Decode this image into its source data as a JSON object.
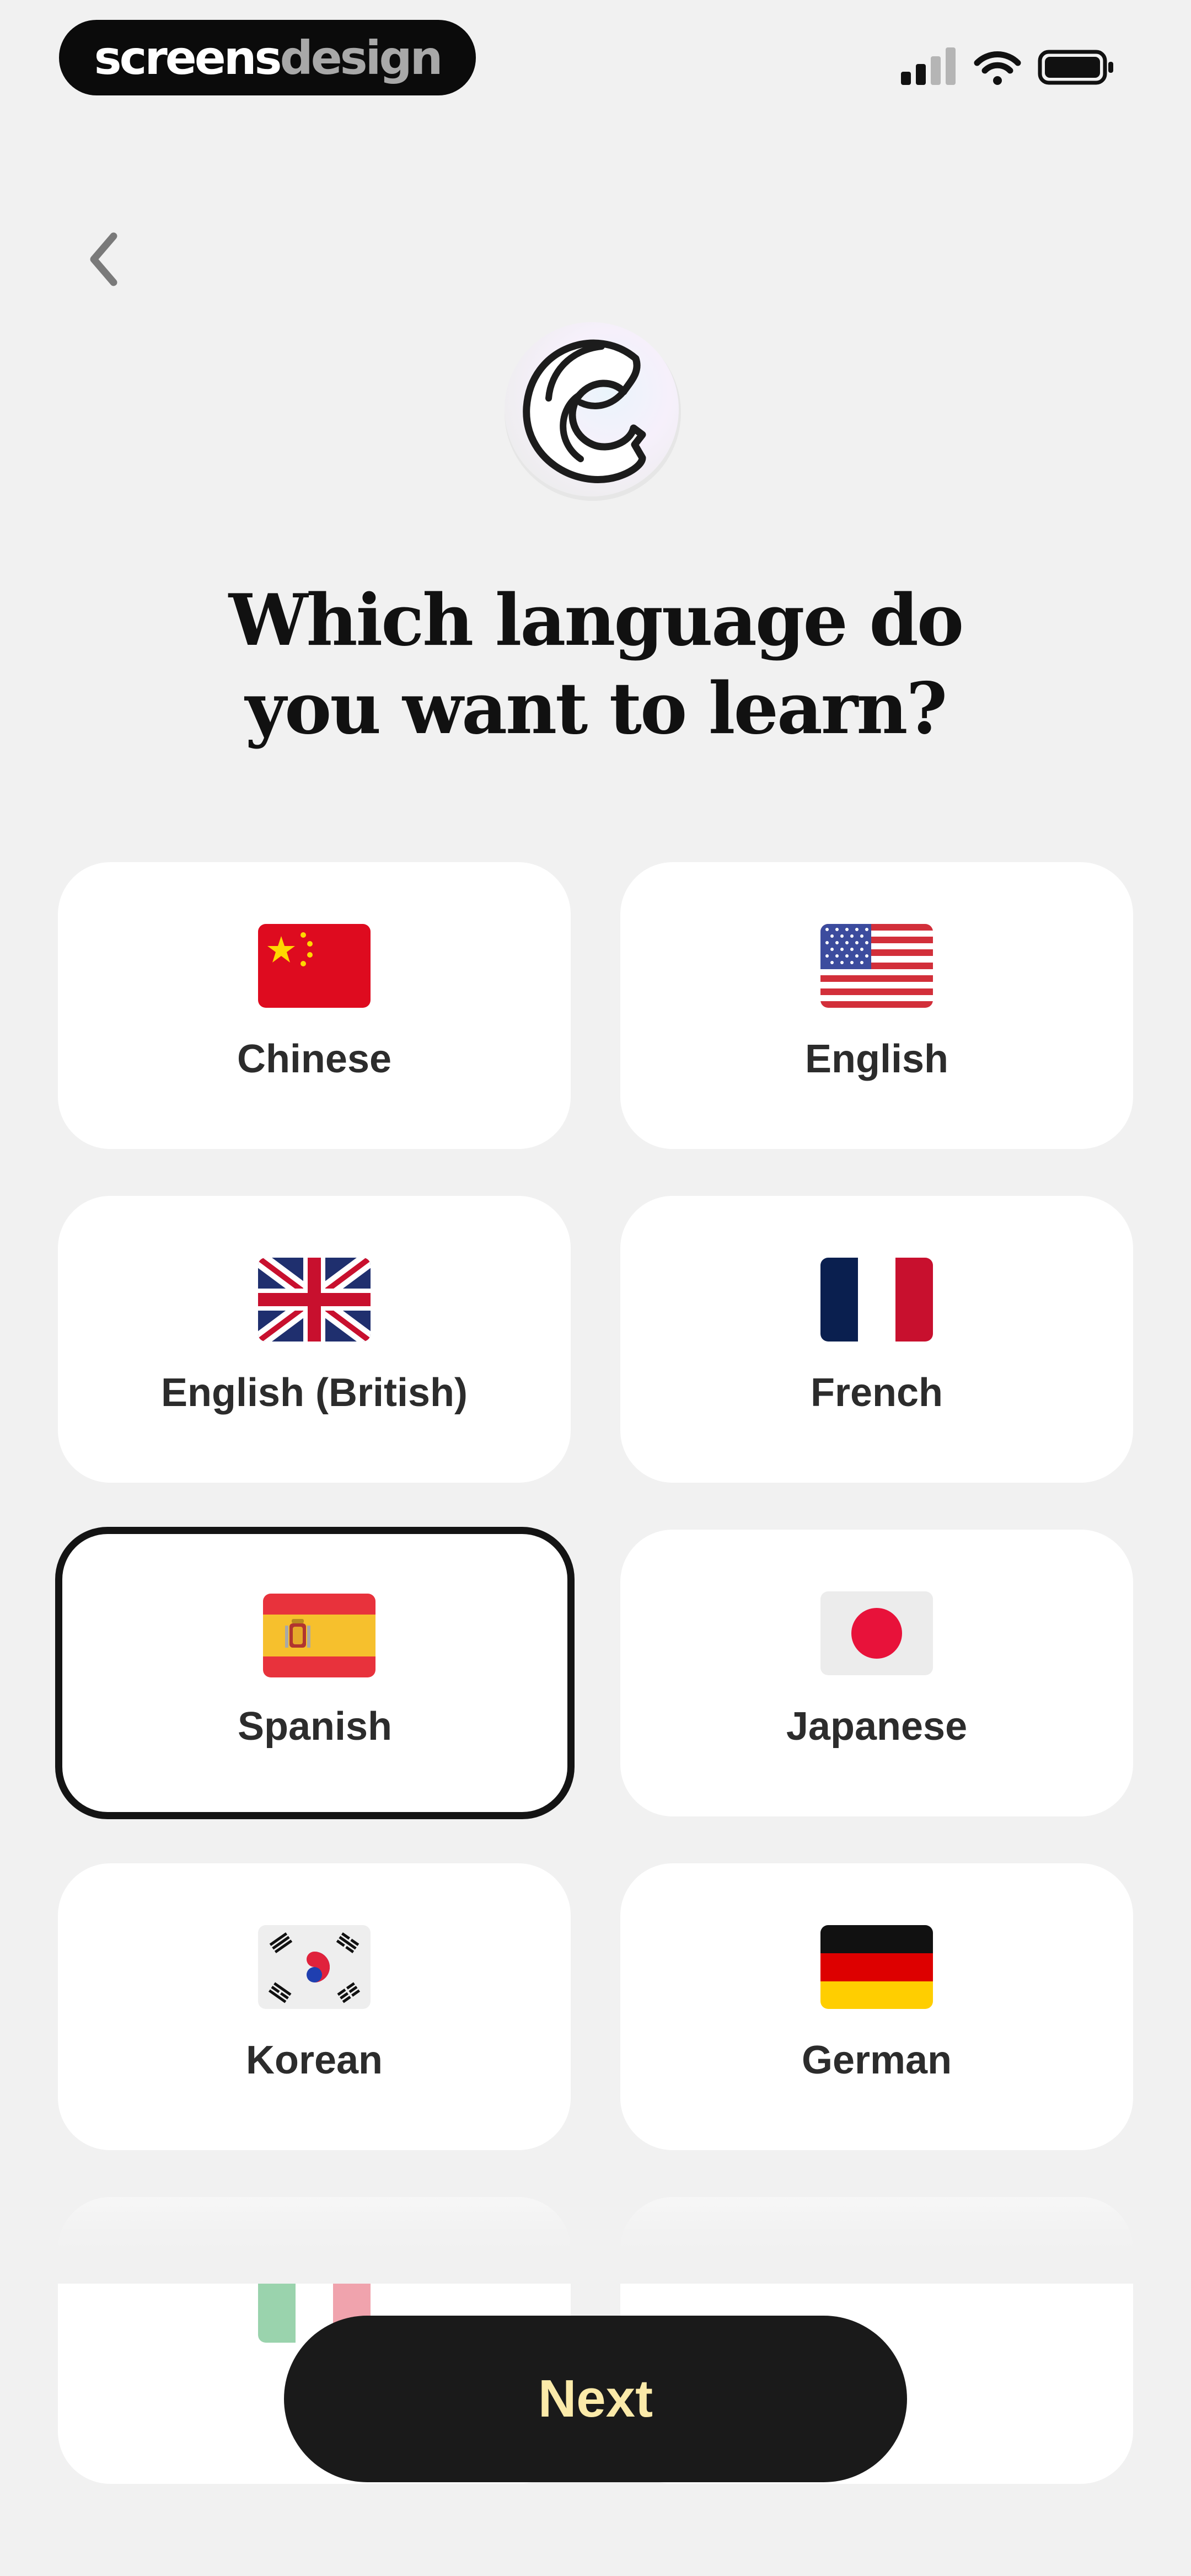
{
  "header": {
    "badge_part1": "screens",
    "badge_part2": "design",
    "status_icons": [
      "cellular-signal-icon",
      "wifi-icon",
      "battery-icon"
    ]
  },
  "nav": {
    "back_icon": "chevron-left-icon"
  },
  "logo_icon": "wave-moon-logo-icon",
  "title_line1": "Which language do",
  "title_line2": "you want to learn?",
  "languages": [
    {
      "label": "Chinese",
      "flag": "china-flag-icon",
      "selected": false
    },
    {
      "label": "English",
      "flag": "usa-flag-icon",
      "selected": false
    },
    {
      "label": "English (British)",
      "flag": "uk-flag-icon",
      "selected": false
    },
    {
      "label": "French",
      "flag": "france-flag-icon",
      "selected": false
    },
    {
      "label": "Spanish",
      "flag": "spain-flag-icon",
      "selected": true
    },
    {
      "label": "Japanese",
      "flag": "japan-flag-icon",
      "selected": false
    },
    {
      "label": "Korean",
      "flag": "korea-flag-icon",
      "selected": false
    },
    {
      "label": "German",
      "flag": "germany-flag-icon",
      "selected": false
    }
  ],
  "next_button": {
    "label": "Next"
  },
  "colors": {
    "background": "#f1f1f1",
    "card": "#ffffff",
    "selected_border": "#141414",
    "button_bg": "#1a1a1a",
    "button_text": "#fbeaa9"
  }
}
